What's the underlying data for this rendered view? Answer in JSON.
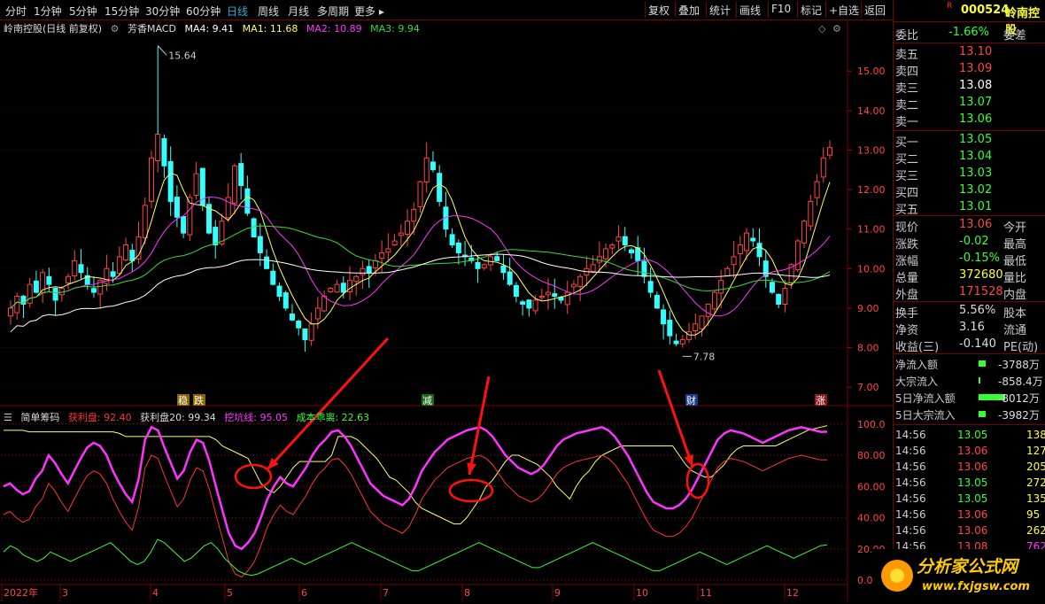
{
  "topbar": {
    "tabs": [
      "分时",
      "1分钟",
      "5分钟",
      "15分钟",
      "30分钟",
      "60分钟",
      "日线",
      "周线",
      "月线",
      "多周期",
      "更多 ▸"
    ],
    "active": "日线",
    "buttons": [
      "复权",
      "叠加",
      "统计",
      "画线",
      "F10",
      "标记",
      "+自选",
      "返回"
    ]
  },
  "main_legend": {
    "title": "岭南控股(日线 前复权)",
    "indicator": "芳香MACD",
    "ma4": "MA4: 9.41",
    "ma1": "MA1: 11.68",
    "ma2": "MA2: 10.89",
    "ma3": "MA3: 9.94"
  },
  "indicator_legend": {
    "name": "简单筹码",
    "l1": "获利盘: 92.40",
    "l2": "获利盘20: 99.34",
    "l3": "挖坑线: 95.05",
    "l4": "成本乖离: 22.63"
  },
  "colors": {
    "ma4": "#ffffff",
    "ma1": "#ffff66",
    "ma2": "#ff33ff",
    "ma3": "#33dd33",
    "up": "#ff4444",
    "down": "#33ffff",
    "accent": "#3ad",
    "red": "#ff3333",
    "green": "#33ff33",
    "yellow": "#ffff33"
  },
  "chart_data": {
    "type": "candlestick",
    "price_axis": [
      "15.00",
      "14.00",
      "13.00",
      "12.00",
      "11.00",
      "10.00",
      "9.00",
      "8.00",
      "7.00"
    ],
    "indicator_axis": [
      "100.0",
      "80.00",
      "60.00",
      "40.00",
      "20.00",
      "0.00"
    ],
    "x_labels": [
      "2022年",
      "3",
      "4",
      "5",
      "6",
      "7",
      "8",
      "9",
      "10",
      "11",
      "12"
    ],
    "high_label": "15.64",
    "low_label": "7.78",
    "markers": [
      "稳",
      "跌",
      "减",
      "财",
      "涨"
    ],
    "closes": [
      9.0,
      9.3,
      9.1,
      9.6,
      9.4,
      9.9,
      9.6,
      9.2,
      9.5,
      9.8,
      10.2,
      9.9,
      9.6,
      9.4,
      9.7,
      10.0,
      9.8,
      10.3,
      10.6,
      10.2,
      10.8,
      11.6,
      12.8,
      13.4,
      12.6,
      11.7,
      11.3,
      10.9,
      11.8,
      12.4,
      11.6,
      10.9,
      10.6,
      11.2,
      11.8,
      12.6,
      12.1,
      11.4,
      10.8,
      10.4,
      10.0,
      9.6,
      9.3,
      9.0,
      8.7,
      8.5,
      8.2,
      8.6,
      9.0,
      9.3,
      9.5,
      9.6,
      9.4,
      9.7,
      9.8,
      10.0,
      9.9,
      10.2,
      10.4,
      10.5,
      10.7,
      10.9,
      11.2,
      11.5,
      12.2,
      12.8,
      12.5,
      11.7,
      11.0,
      10.6,
      10.4,
      10.3,
      10.2,
      10.0,
      10.1,
      10.3,
      10.2,
      9.9,
      9.6,
      9.3,
      9.1,
      9.0,
      9.2,
      9.3,
      9.4,
      9.3,
      9.2,
      9.4,
      9.6,
      9.8,
      10.0,
      10.1,
      10.3,
      10.5,
      10.6,
      10.8,
      10.6,
      10.4,
      10.2,
      9.8,
      9.4,
      9.0,
      8.6,
      8.3,
      8.1,
      8.2,
      8.4,
      8.6,
      8.8,
      9.1,
      9.4,
      9.7,
      10.0,
      10.3,
      10.6,
      10.9,
      10.7,
      10.3,
      9.8,
      9.4,
      9.1,
      9.5,
      10.1,
      10.7,
      11.2,
      11.7,
      12.2,
      12.8,
      13.06
    ],
    "huoli": [
      60,
      62,
      58,
      55,
      57,
      65,
      70,
      80,
      75,
      68,
      62,
      70,
      78,
      85,
      88,
      86,
      80,
      70,
      62,
      55,
      50,
      65,
      90,
      98,
      96,
      85,
      75,
      65,
      70,
      82,
      90,
      88,
      76,
      60,
      45,
      30,
      22,
      20,
      24,
      30,
      40,
      52,
      60,
      66,
      62,
      60,
      66,
      72,
      80,
      86,
      90,
      95,
      96,
      92,
      86,
      78,
      70,
      62,
      58,
      54,
      52,
      50,
      48,
      52,
      60,
      70,
      76,
      82,
      86,
      90,
      92,
      94,
      96,
      97,
      98,
      96,
      92,
      86,
      80,
      76,
      72,
      70,
      68,
      70,
      74,
      80,
      86,
      90,
      92,
      94,
      95,
      96,
      97,
      98,
      96,
      92,
      86,
      80,
      72,
      64,
      56,
      50,
      48,
      46,
      46,
      48,
      52,
      58,
      66,
      74,
      82,
      90,
      94,
      96,
      95,
      94,
      92,
      90,
      88,
      90,
      92,
      94,
      96,
      97,
      98,
      97,
      96,
      95,
      95.05
    ],
    "yellow": [
      96,
      96,
      96,
      96,
      95,
      95,
      95,
      95,
      95,
      95,
      95,
      95,
      95,
      95,
      95,
      95,
      95,
      95,
      94,
      92,
      92,
      92,
      92,
      92,
      92,
      92,
      92,
      92,
      92,
      92,
      92,
      92,
      92,
      90,
      86,
      84,
      82,
      80,
      78,
      70,
      62,
      58,
      56,
      60,
      66,
      72,
      76,
      76,
      76,
      76,
      76,
      80,
      92,
      92,
      92,
      90,
      86,
      82,
      78,
      72,
      66,
      64,
      60,
      56,
      50,
      46,
      44,
      42,
      40,
      38,
      36,
      36,
      40,
      46,
      52,
      60,
      64,
      70,
      76,
      80,
      80,
      78,
      76,
      74,
      70,
      66,
      60,
      56,
      52,
      60,
      66,
      70,
      76,
      80,
      82,
      84,
      86,
      86,
      86,
      86,
      86,
      86,
      86,
      86,
      86,
      80,
      74,
      70,
      68,
      66,
      66,
      70,
      74,
      80,
      84,
      86,
      86,
      86,
      86,
      86,
      86,
      88,
      90,
      92,
      94,
      96,
      97,
      98,
      99
    ],
    "green": [
      18,
      22,
      20,
      16,
      14,
      12,
      14,
      18,
      16,
      14,
      12,
      14,
      16,
      18,
      20,
      22,
      24,
      20,
      16,
      12,
      10,
      12,
      18,
      26,
      24,
      20,
      16,
      12,
      14,
      18,
      22,
      24,
      20,
      14,
      10,
      6,
      4,
      3,
      4,
      6,
      8,
      10,
      12,
      14,
      12,
      10,
      12,
      14,
      16,
      18,
      20,
      22,
      24,
      22,
      20,
      18,
      16,
      14,
      12,
      10,
      8,
      6,
      6,
      8,
      10,
      12,
      14,
      16,
      18,
      20,
      22,
      24,
      22,
      20,
      18,
      16,
      14,
      12,
      10,
      8,
      8,
      10,
      12,
      14,
      16,
      18,
      20,
      22,
      24,
      22,
      20,
      18,
      16,
      14,
      12,
      10,
      8,
      6,
      6,
      8,
      10,
      12,
      14,
      16,
      18,
      16,
      14,
      12,
      10,
      12,
      14,
      16,
      18,
      20,
      22,
      20,
      18,
      16,
      14,
      16,
      18,
      20,
      22,
      22.63
    ]
  },
  "right_panel": {
    "code": "000524",
    "name": "岭南控股",
    "r_badge": "R",
    "weibi_label": "委比",
    "weibi_value": "-1.66%",
    "weicha_label": "委差",
    "asks": [
      {
        "label": "卖五",
        "price": "13.10"
      },
      {
        "label": "卖四",
        "price": "13.09"
      },
      {
        "label": "卖三",
        "price": "13.08"
      },
      {
        "label": "卖二",
        "price": "13.07"
      },
      {
        "label": "卖一",
        "price": "13.06"
      }
    ],
    "bids": [
      {
        "label": "买一",
        "price": "13.05"
      },
      {
        "label": "买二",
        "price": "13.04"
      },
      {
        "label": "买三",
        "price": "13.03"
      },
      {
        "label": "买四",
        "price": "13.02"
      },
      {
        "label": "买五",
        "price": "13.01"
      }
    ],
    "quote": [
      {
        "l": "现价",
        "v": "13.06",
        "r": "今开",
        "vc": "#ff4444"
      },
      {
        "l": "涨跌",
        "v": "-0.02",
        "r": "最高",
        "vc": "#33ff33"
      },
      {
        "l": "涨幅",
        "v": "-0.15%",
        "r": "最低",
        "vc": "#33ff33"
      },
      {
        "l": "总量",
        "v": "372680",
        "r": "量比",
        "vc": "#ffff33"
      },
      {
        "l": "外盘",
        "v": "171528",
        "r": "内盘",
        "vc": "#ff4444"
      }
    ],
    "quote2": [
      {
        "l": "换手",
        "v": "5.56%",
        "r": "股本",
        "vc": "#ddd"
      },
      {
        "l": "净资",
        "v": "3.16",
        "r": "流通",
        "vc": "#ddd"
      },
      {
        "l": "收益(三)",
        "v": "-0.140",
        "r": "PE(动)",
        "vc": "#ddd"
      }
    ],
    "flows": [
      {
        "l": "净流入额",
        "v": "-3788万"
      },
      {
        "l": "大宗流入",
        "v": "-858.4万"
      },
      {
        "l": "5日净流入额",
        "v": "-8012万"
      },
      {
        "l": "5日大宗流入",
        "v": "-3982万"
      }
    ],
    "trades": [
      {
        "t": "14:56",
        "p": "13.05",
        "q": "138",
        "qc": "#ffff33"
      },
      {
        "t": "14:56",
        "p": "13.06",
        "q": "127",
        "qc": "#ffff33"
      },
      {
        "t": "14:56",
        "p": "13.06",
        "q": "205",
        "qc": "#ffff33"
      },
      {
        "t": "14:56",
        "p": "13.05",
        "q": "272",
        "qc": "#ffff33"
      },
      {
        "t": "14:56",
        "p": "13.05",
        "q": "135",
        "qc": "#ffff33"
      },
      {
        "t": "14:56",
        "p": "13.06",
        "q": "95",
        "qc": "#ffff33"
      },
      {
        "t": "14:56",
        "p": "13.06",
        "q": "262",
        "qc": "#ffff33"
      },
      {
        "t": "14:56",
        "p": "13.08",
        "q": "762",
        "qc": "#ff33ff"
      }
    ],
    "logo_text": "分析家公式网",
    "logo_url": "www.fxjgsw.com"
  }
}
